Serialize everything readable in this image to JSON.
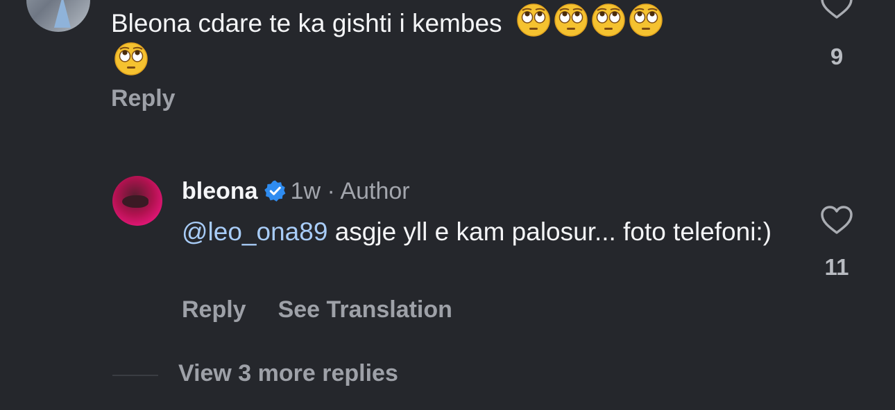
{
  "top_comment": {
    "text": "Bleona cdare te ka gishti i kembes",
    "emoji_count": 5,
    "emoji_icon": "face-with-rolling-eyes-icon",
    "reply_label": "Reply",
    "like_count": "9"
  },
  "reply_comment": {
    "username": "bleona",
    "time": "1w",
    "separator": "·",
    "author_label": "Author",
    "mention": "@leo_ona89",
    "text": "asgje yll e kam palosur... foto telefoni:)",
    "reply_label": "Reply",
    "translation_label": "See Translation",
    "like_count": "11"
  },
  "view_more_replies": "View 3 more replies",
  "colors": {
    "background": "#25272c",
    "text": "#f4f5f7",
    "muted": "#9ea1a8",
    "mention": "#a8ccf7",
    "verified": "#2f8cf0"
  }
}
